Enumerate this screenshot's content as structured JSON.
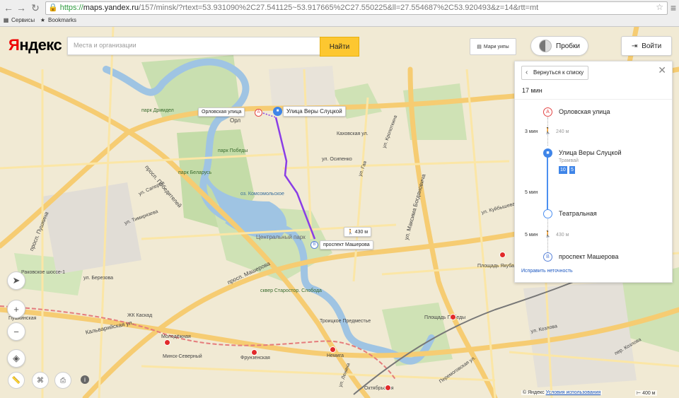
{
  "browser": {
    "url_protocol": "https://",
    "url_host": "maps.yandex.ru",
    "url_rest": "/157/minsk/?rtext=53.931090%2C27.541125~53.917665%2C27.550225&ll=27.554687%2C53.920493&z=14&rtt=mt",
    "bookmarks": [
      {
        "label": "Сервисы",
        "icon": "apps-icon"
      },
      {
        "label": "Bookmarks",
        "icon": "star-icon"
      }
    ]
  },
  "header": {
    "logo_first": "Я",
    "logo_rest": "ндекс",
    "search_placeholder": "Места и организации",
    "search_button": "Найти",
    "layers_label": "Мари уипы",
    "traffic_label": "Пробки",
    "login_label": "Войти"
  },
  "panel": {
    "back_label": "Вернуться к списку",
    "duration": "17 мин",
    "steps": {
      "start": {
        "marker": "A",
        "name": "Орловская улица"
      },
      "walk1": {
        "time": "3 мин",
        "distance": "240 м"
      },
      "tram_stop": {
        "name": "Улица Веры Слуцкой",
        "mode": "Трамвай",
        "routes": [
          "10",
          "5"
        ]
      },
      "ride": {
        "time": "5 мин"
      },
      "exit_stop": {
        "name": "Театральная"
      },
      "walk2": {
        "time": "5 мин",
        "distance": "430 м"
      },
      "end": {
        "marker": "B",
        "name": "проспект Машерова"
      }
    },
    "report_link": "Исправить неточность"
  },
  "map": {
    "callouts": {
      "start": "Орловская улица",
      "start_marker": "A",
      "tram": "Улица Веры Слуцкой",
      "walk": "430 м",
      "end": "проспект Машерова",
      "end_marker": "B"
    },
    "labels": {
      "park_dromdel": "парк Дримдел",
      "park_pobedy": "парк Победы",
      "park_belarus": "парк Беларусь",
      "lake_komsomol": "оз. Комсомольское",
      "central_park": "Центральный парк",
      "prosp_pobediteley": "просп. Победителей",
      "prosp_pushkina": "просп. Пушкина",
      "prosp_masherova": "просп. Машерова",
      "ul_timiryazeva": "ул. Тимирязева",
      "kalvariyskaya": "Кальварийская ул.",
      "orlovskaya": "Орл",
      "kakhovskaya": "Каховская ул.",
      "osipenko": "ул. Осипенко",
      "kropotkina": "ул. Кропоткина",
      "bogdanovicha": "ул. Максима Богдановича",
      "starostorozhevskaya": "Старостор.",
      "pobedy_sq": "Площадь Победы",
      "yakuba_kolasa": "Площадь Якуба Коласа",
      "nemiga": "Немига",
      "frunzenskaya": "Фрунзенская",
      "molodezhnaya": "Молодёжная",
      "oktyabrskaya": "Октябрьская",
      "pushkinskaya": "Пушкинская",
      "minsk_severny": "Минск-Северный",
      "zhk_kaskad": "ЖК Каскад",
      "troitskoe": "Троицкое Предместье",
      "starostorozhevskaya_sloboda": "сквер Старостор. Слобода",
      "kozlova": "ул. Козлова",
      "per_kozlova": "пер. Козлова",
      "raykovskoe": "Раковское шоссе-1",
      "ul_berezova": "ул. Березова",
      "ul_saperova": "ул. Саперов",
      "ul_gaya": "ул. Гая",
      "ul_kuibysheva": "ул. Куйбышева",
      "peremogskaya": "Перемоговская ул.",
      "ul_lenina": "ул. Ленина"
    }
  },
  "footer": {
    "copyright": "© Яндекс",
    "terms": "Условия использования",
    "scale": "400 м"
  },
  "colors": {
    "route_tram": "#8a3de6",
    "accent_search": "#fdc730",
    "marker_a": "#e34545",
    "marker_b": "#5b84d9",
    "tram_blue": "#3f85e8"
  }
}
